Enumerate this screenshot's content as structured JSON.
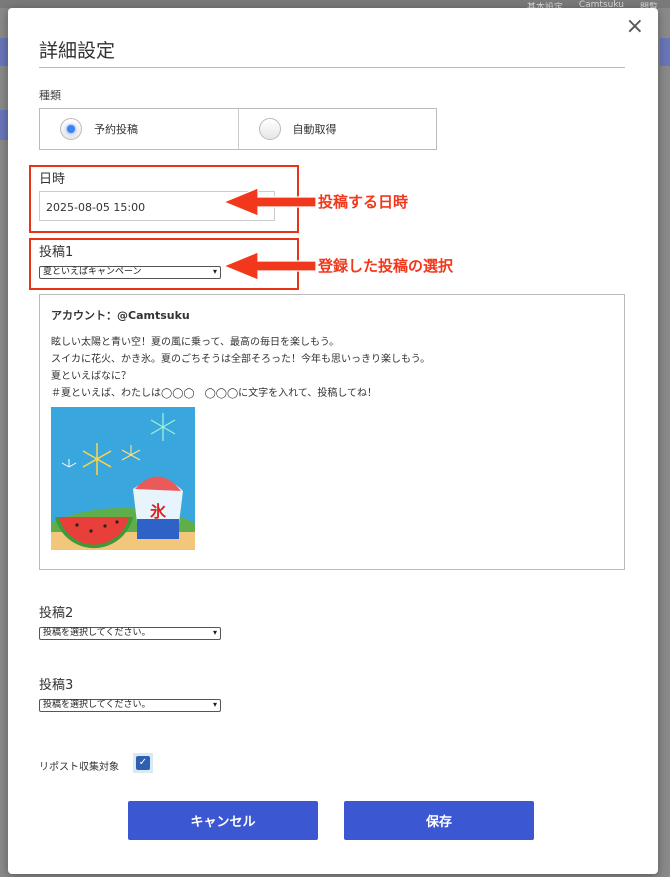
{
  "background": {
    "tabs": [
      "基本設定",
      "Camtsuku",
      "閲覧"
    ]
  },
  "modal": {
    "title": "詳細設定",
    "close_icon": "×"
  },
  "type_section": {
    "label": "種類",
    "options": [
      {
        "label": "予約投稿",
        "selected": true
      },
      {
        "label": "自動取得",
        "selected": false
      }
    ]
  },
  "datetime_section": {
    "label": "日時",
    "value": "2025-08-05 15:00"
  },
  "post1": {
    "label": "投稿1",
    "selected": "夏といえばキャンペーン"
  },
  "preview": {
    "account": "アカウント：@Camtsuku",
    "lines": [
      "眩しい太陽と青い空！夏の風に乗って、最高の毎日を楽しもう。",
      "スイカに花火、かき氷。夏のごちそうは全部そろった！今年も思いっきり楽しもう。",
      "夏といえばなに？",
      "＃夏といえば、わたしは◯◯◯　◯◯◯に文字を入れて、投稿してね！"
    ],
    "image_text": "氷"
  },
  "post2": {
    "label": "投稿2",
    "selected": "投稿を選択してください。"
  },
  "post3": {
    "label": "投稿3",
    "selected": "投稿を選択してください。"
  },
  "repost": {
    "label": "リポスト収集対象",
    "checked": true
  },
  "buttons": {
    "cancel": "キャンセル",
    "save": "保存"
  },
  "annotations": {
    "datetime": "投稿する日時",
    "post_select": "登録した投稿の選択"
  },
  "colors": {
    "primary": "#3c57d2",
    "annotation": "#e8331b",
    "radio_selected": "#3b82f6"
  }
}
